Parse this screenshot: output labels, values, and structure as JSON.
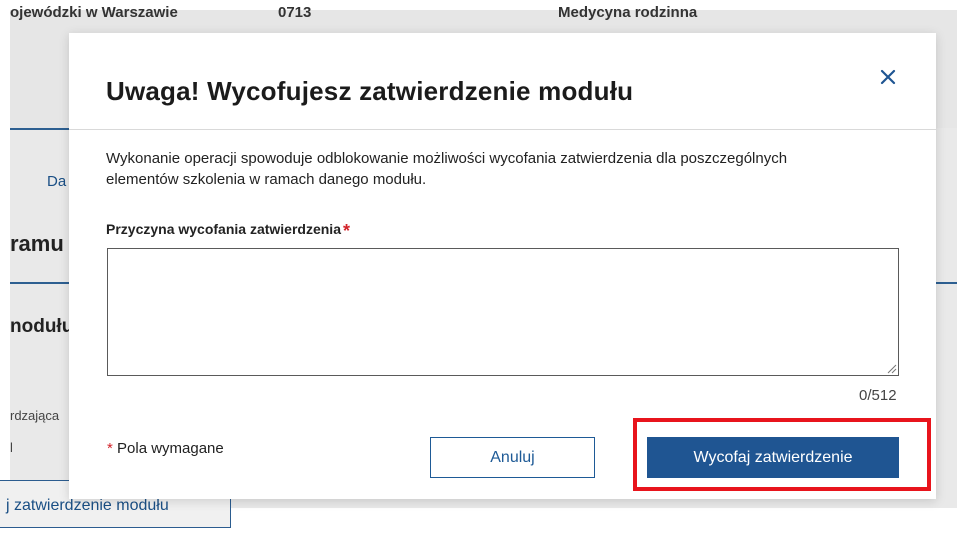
{
  "background": {
    "top_left_text": "ojewódzki w Warszawie",
    "top_mid_text": "0713",
    "top_right_text": "Medycyna rodzinna",
    "link_text": "Da",
    "heading_text": "ramu",
    "sub_text": "nodułu",
    "small_text": "rdzająca",
    "small_value": "l",
    "button_text": "j zatwierdzenie modułu"
  },
  "modal": {
    "title": "Uwaga! Wycofujesz zatwierdzenie modułu",
    "close_icon": "close-icon",
    "description": "Wykonanie operacji spowoduje odblokowanie możliwości wycofania zatwierdzenia dla poszczególnych elementów szkolenia w ramach danego modułu.",
    "field_label": "Przyczyna wycofania zatwierdzenia",
    "required_star": "*",
    "textarea_value": "",
    "counter": "0/512",
    "required_note_star": "*",
    "required_note": "Pola wymagane",
    "cancel_label": "Anuluj",
    "confirm_label": "Wycofaj zatwierdzenie"
  },
  "colors": {
    "primary": "#1f5592",
    "required": "#d2232a",
    "highlight": "#e8141c"
  }
}
